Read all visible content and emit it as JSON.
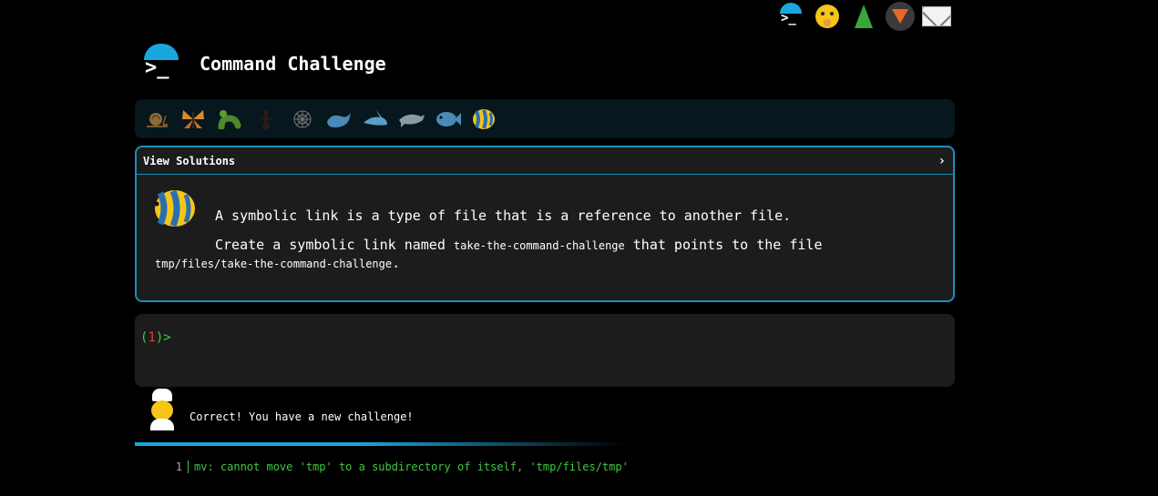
{
  "top_nav": {
    "icons": [
      "terminal-icon",
      "shushing-face-icon",
      "tree-icon",
      "gitlab-icon",
      "envelope-icon"
    ]
  },
  "header": {
    "title": "Command Challenge"
  },
  "levels": [
    "snail-icon",
    "butterfly-icon",
    "bug-icon",
    "ant-icon",
    "spider-web-icon",
    "whale-icon",
    "shark-icon",
    "dolphin-icon",
    "fish-icon",
    "tropical-fish-icon"
  ],
  "challenge": {
    "toggle_label": "View Solutions",
    "chevron": "›",
    "icon": "tropical-fish-icon",
    "intro": "A symbolic link is a type of file that is a reference to another file.",
    "task_prefix": "Create a symbolic link named ",
    "link_name": "take-the-command-challenge",
    "task_middle": " that points to the file ",
    "target_path": "tmp/files/take-the-command-challenge",
    "task_suffix": "."
  },
  "terminal": {
    "prompt_open": "(",
    "prompt_number": "1",
    "prompt_close": ")>"
  },
  "result": {
    "message": "Correct! You have a new challenge!"
  },
  "output": {
    "line_number": "1",
    "text": "mv: cannot move 'tmp' to a subdirectory of itself, 'tmp/files/tmp'"
  },
  "colors": {
    "accent": "#1aa7e0",
    "prompt": "#3ec93e",
    "error_number": "#e03a3a"
  }
}
